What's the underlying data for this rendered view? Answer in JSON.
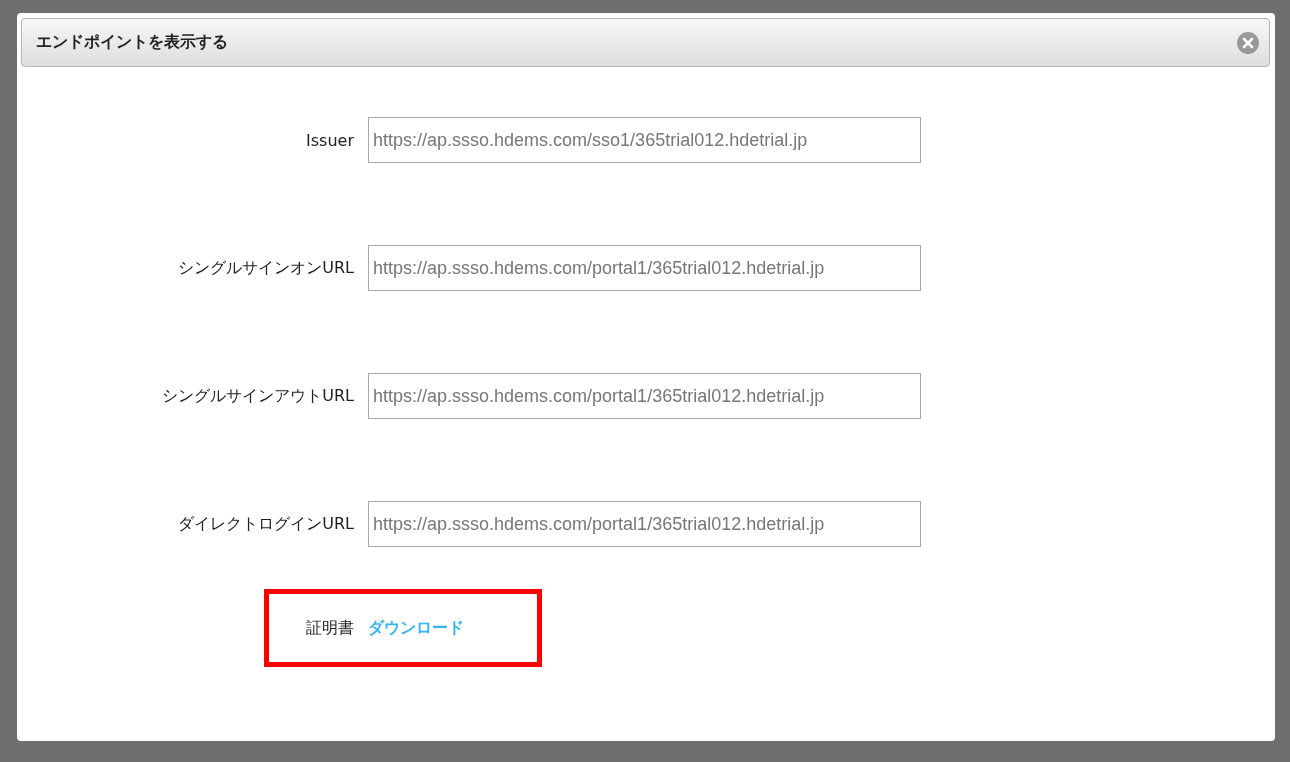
{
  "dialog": {
    "title": "エンドポイントを表示する",
    "fields": [
      {
        "label": "Issuer",
        "value": "https://ap.ssso.hdems.com/sso1/365trial012.hdetrial.jp"
      },
      {
        "label": "シングルサインオンURL",
        "value": "https://ap.ssso.hdems.com/portal1/365trial012.hdetrial.jp"
      },
      {
        "label": "シングルサインアウトURL",
        "value": "https://ap.ssso.hdems.com/portal1/365trial012.hdetrial.jp"
      },
      {
        "label": "ダイレクトログインURL",
        "value": "https://ap.ssso.hdems.com/portal1/365trial012.hdetrial.jp"
      }
    ],
    "certificate": {
      "label": "証明書",
      "link": "ダウンロード",
      "highlighted": true
    }
  }
}
